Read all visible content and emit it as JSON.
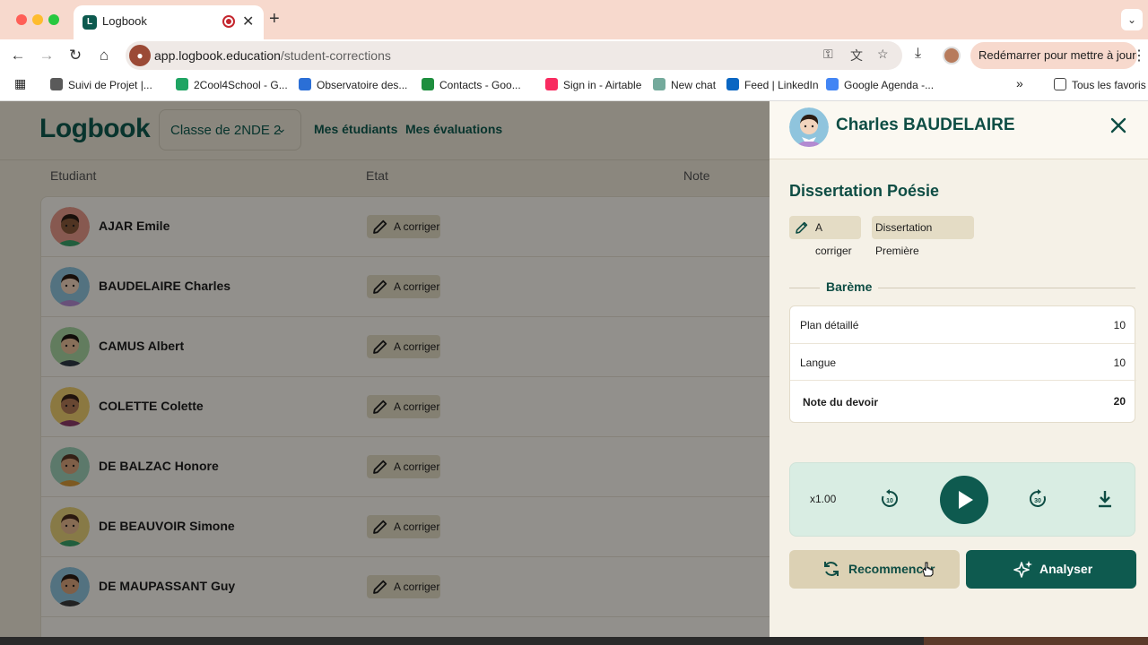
{
  "browser": {
    "tab_title": "Logbook",
    "tab_close": "✕",
    "new_tab": "+",
    "url_host": "app.logbook.education",
    "url_path": "/student-corrections",
    "update_label": "Redémarrer pour mettre à jour",
    "bookmarks": [
      {
        "label": "Suivi de Projet |...",
        "color": "#5a5a5a"
      },
      {
        "label": "2Cool4School - G...",
        "color": "#1fa463"
      },
      {
        "label": "Observatoire des...",
        "color": "#2b6fd6"
      },
      {
        "label": "Contacts - Goo...",
        "color": "#1e8e3e"
      },
      {
        "label": "Sign in - Airtable",
        "color": "#f82b60"
      },
      {
        "label": "New chat",
        "color": "#74aa9c"
      },
      {
        "label": "Feed | LinkedIn",
        "color": "#0a66c2"
      },
      {
        "label": "Google Agenda -...",
        "color": "#4285f4"
      }
    ],
    "bookmarks_overflow": "»",
    "all_bookmarks": "Tous les favoris"
  },
  "app": {
    "logo": "Logbook",
    "class_select": "Classe de 2NDE 2",
    "nav": [
      "Mes étudiants",
      "Mes évaluations"
    ],
    "columns": [
      "Etudiant",
      "Etat",
      "Note"
    ],
    "students": [
      {
        "name": "AJAR Emile",
        "status": "A corriger",
        "bg": "#e89a8a",
        "skin": "#8a5a3c",
        "hair": "#2b1d14",
        "shirt": "#3aa36a"
      },
      {
        "name": "BAUDELAIRE Charles",
        "status": "A corriger",
        "bg": "#8fc4dd",
        "skin": "#f2d4bd",
        "hair": "#2b1d14",
        "shirt": "#b38ad1"
      },
      {
        "name": "CAMUS Albert",
        "status": "A corriger",
        "bg": "#a9d6a3",
        "skin": "#e8c09a",
        "hair": "#1e1712",
        "shirt": "#2f3a45"
      },
      {
        "name": "COLETTE Colette",
        "status": "A corriger",
        "bg": "#f0cf6e",
        "skin": "#b47a56",
        "hair": "#3a2418",
        "shirt": "#8e3b6a"
      },
      {
        "name": "DE BALZAC Honore",
        "status": "A corriger",
        "bg": "#9fd1b9",
        "skin": "#d9a47c",
        "hair": "#5a3a26",
        "shirt": "#d89a3a"
      },
      {
        "name": "DE BEAUVOIR Simone",
        "status": "A corriger",
        "bg": "#e9d27a",
        "skin": "#e7b98f",
        "hair": "#4a2e1d",
        "shirt": "#3aa36a"
      },
      {
        "name": "DE MAUPASSANT Guy",
        "status": "A corriger",
        "bg": "#8fc4dd",
        "skin": "#d9a47c",
        "hair": "#2b1d14",
        "shirt": "#3b3b3b"
      }
    ]
  },
  "panel": {
    "student_name": "Charles BAUDELAIRE",
    "essay_title": "Dissertation Poésie",
    "status_tag": "A corriger",
    "type_tag": "Dissertation Première",
    "bareme_label": "Barème",
    "criteria": [
      {
        "label": "Plan détaillé",
        "value": "10"
      },
      {
        "label": "Langue",
        "value": "10"
      }
    ],
    "total": {
      "label": "Note du devoir",
      "value": "20"
    },
    "player": {
      "speed": "x1.00",
      "rewind_seconds": 10,
      "forward_seconds": 30
    },
    "restart_label": "Recommencer",
    "analyse_label": "Analyser"
  },
  "colors": {
    "brand": "#0e5a4f",
    "panel_bg": "#f5f1e7",
    "tag_bg": "#e4dcc5"
  }
}
